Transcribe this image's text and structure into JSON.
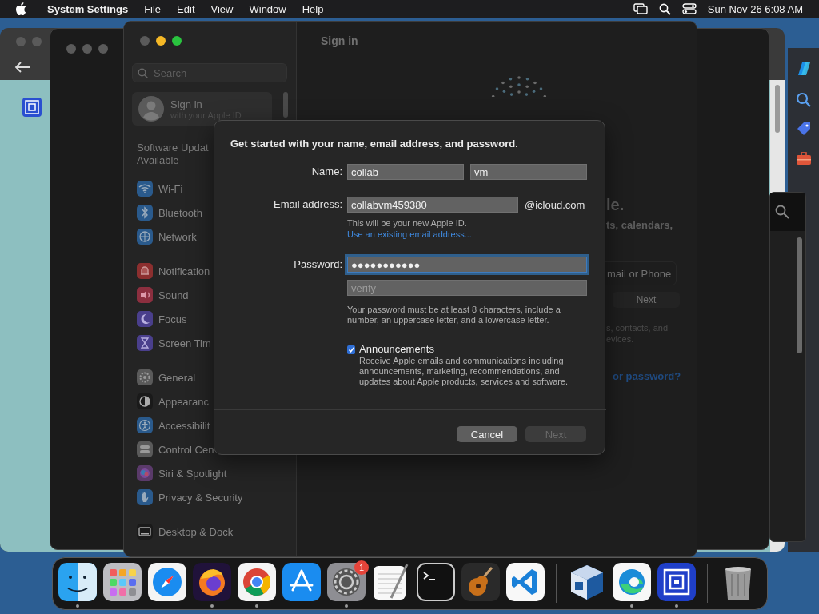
{
  "menu_bar": {
    "app": "System Settings",
    "menus": [
      "File",
      "Edit",
      "View",
      "Window",
      "Help"
    ],
    "clock": "Sun Nov 26  6:08 AM"
  },
  "settings_window": {
    "title": "Sign in",
    "search": {
      "placeholder": "Search"
    },
    "account": {
      "title": "Sign in",
      "subtitle": "with your Apple ID"
    },
    "update_notice": [
      "Software Updat",
      "Available"
    ],
    "sidebar_groups": [
      {
        "items": [
          {
            "label": "Wi-Fi",
            "kind": "wifi",
            "color": "#2a5a8c"
          },
          {
            "label": "Bluetooth",
            "kind": "bluetooth",
            "color": "#2a5a8c"
          },
          {
            "label": "Network",
            "kind": "globe",
            "color": "#2a5a8c"
          }
        ]
      },
      {
        "items": [
          {
            "label": "Notification",
            "kind": "bell",
            "color": "#8c2f2f"
          },
          {
            "label": "Sound",
            "kind": "speaker",
            "color": "#8c2f3f"
          },
          {
            "label": "Focus",
            "kind": "moon",
            "color": "#4a3f8c"
          },
          {
            "label": "Screen Tim",
            "kind": "hourglass",
            "color": "#4a3f8c"
          }
        ]
      },
      {
        "items": [
          {
            "label": "General",
            "kind": "gear",
            "color": "#5a5a5a"
          },
          {
            "label": "Appearanc",
            "kind": "contrast",
            "color": "#1a1a1a"
          },
          {
            "label": "Accessibilit",
            "kind": "person",
            "color": "#2a5a8c"
          },
          {
            "label": "Control Cen",
            "kind": "toggles",
            "color": "#5a5a5a"
          },
          {
            "label": "Siri & Spotlight",
            "kind": "orb",
            "color": "#5a3a6a"
          },
          {
            "label": "Privacy & Security",
            "kind": "hand",
            "color": "#2a5a8c"
          }
        ]
      },
      {
        "items": [
          {
            "label": "Desktop & Dock",
            "kind": "monitor",
            "color": "#1a1a1a"
          }
        ]
      }
    ],
    "behind_sheet": {
      "heading": "le.",
      "subheading": "ts, calendars,",
      "field": {
        "placeholder": "mail or Phone"
      },
      "button": "Next",
      "note": [
        "s, contacts, and",
        "evices."
      ],
      "link": "or password?"
    }
  },
  "dialog": {
    "heading": "Get started with your name, email address, and password.",
    "name": {
      "label": "Name:",
      "first": "collab",
      "last": "vm"
    },
    "email": {
      "label": "Email address:",
      "value": "collabvm459380",
      "suffix": "@icloud.com",
      "hint": "This will be your new Apple ID.",
      "link": "Use an existing email address..."
    },
    "password": {
      "label": "Password:",
      "value": "●●●●●●●●●●●",
      "focused": true
    },
    "verify": {
      "placeholder": "verify"
    },
    "password_rule": "Your password must be at least 8 characters, include a number, an uppercase letter, and a lowercase letter.",
    "announcements": {
      "label": "Announcements",
      "checked": true,
      "description": "Receive Apple emails and communications including announcements, marketing, recommendations, and updates about Apple products, services and software."
    },
    "buttons": [
      {
        "label": "Cancel",
        "disabled": false
      },
      {
        "label": "Next",
        "disabled": true
      }
    ]
  },
  "dock": {
    "groups": [
      {
        "items": [
          {
            "kind": "face",
            "running": true
          },
          {
            "kind": "grid",
            "running": false
          },
          {
            "kind": "compass",
            "running": false
          },
          {
            "kind": "fox",
            "running": true
          },
          {
            "kind": "ring",
            "running": true
          },
          {
            "kind": "letter-a",
            "running": false
          },
          {
            "kind": "gear",
            "running": true,
            "badge": "1"
          },
          {
            "kind": "notepad",
            "running": false
          },
          {
            "kind": "terminal",
            "running": false
          },
          {
            "kind": "guitar",
            "running": false
          },
          {
            "kind": "code",
            "running": false
          }
        ]
      },
      {
        "items": [
          {
            "kind": "cube",
            "running": false
          },
          {
            "kind": "swirl",
            "running": true
          },
          {
            "kind": "squares",
            "running": true
          }
        ]
      },
      {
        "items": [
          {
            "kind": "trash",
            "running": false
          }
        ]
      }
    ]
  }
}
